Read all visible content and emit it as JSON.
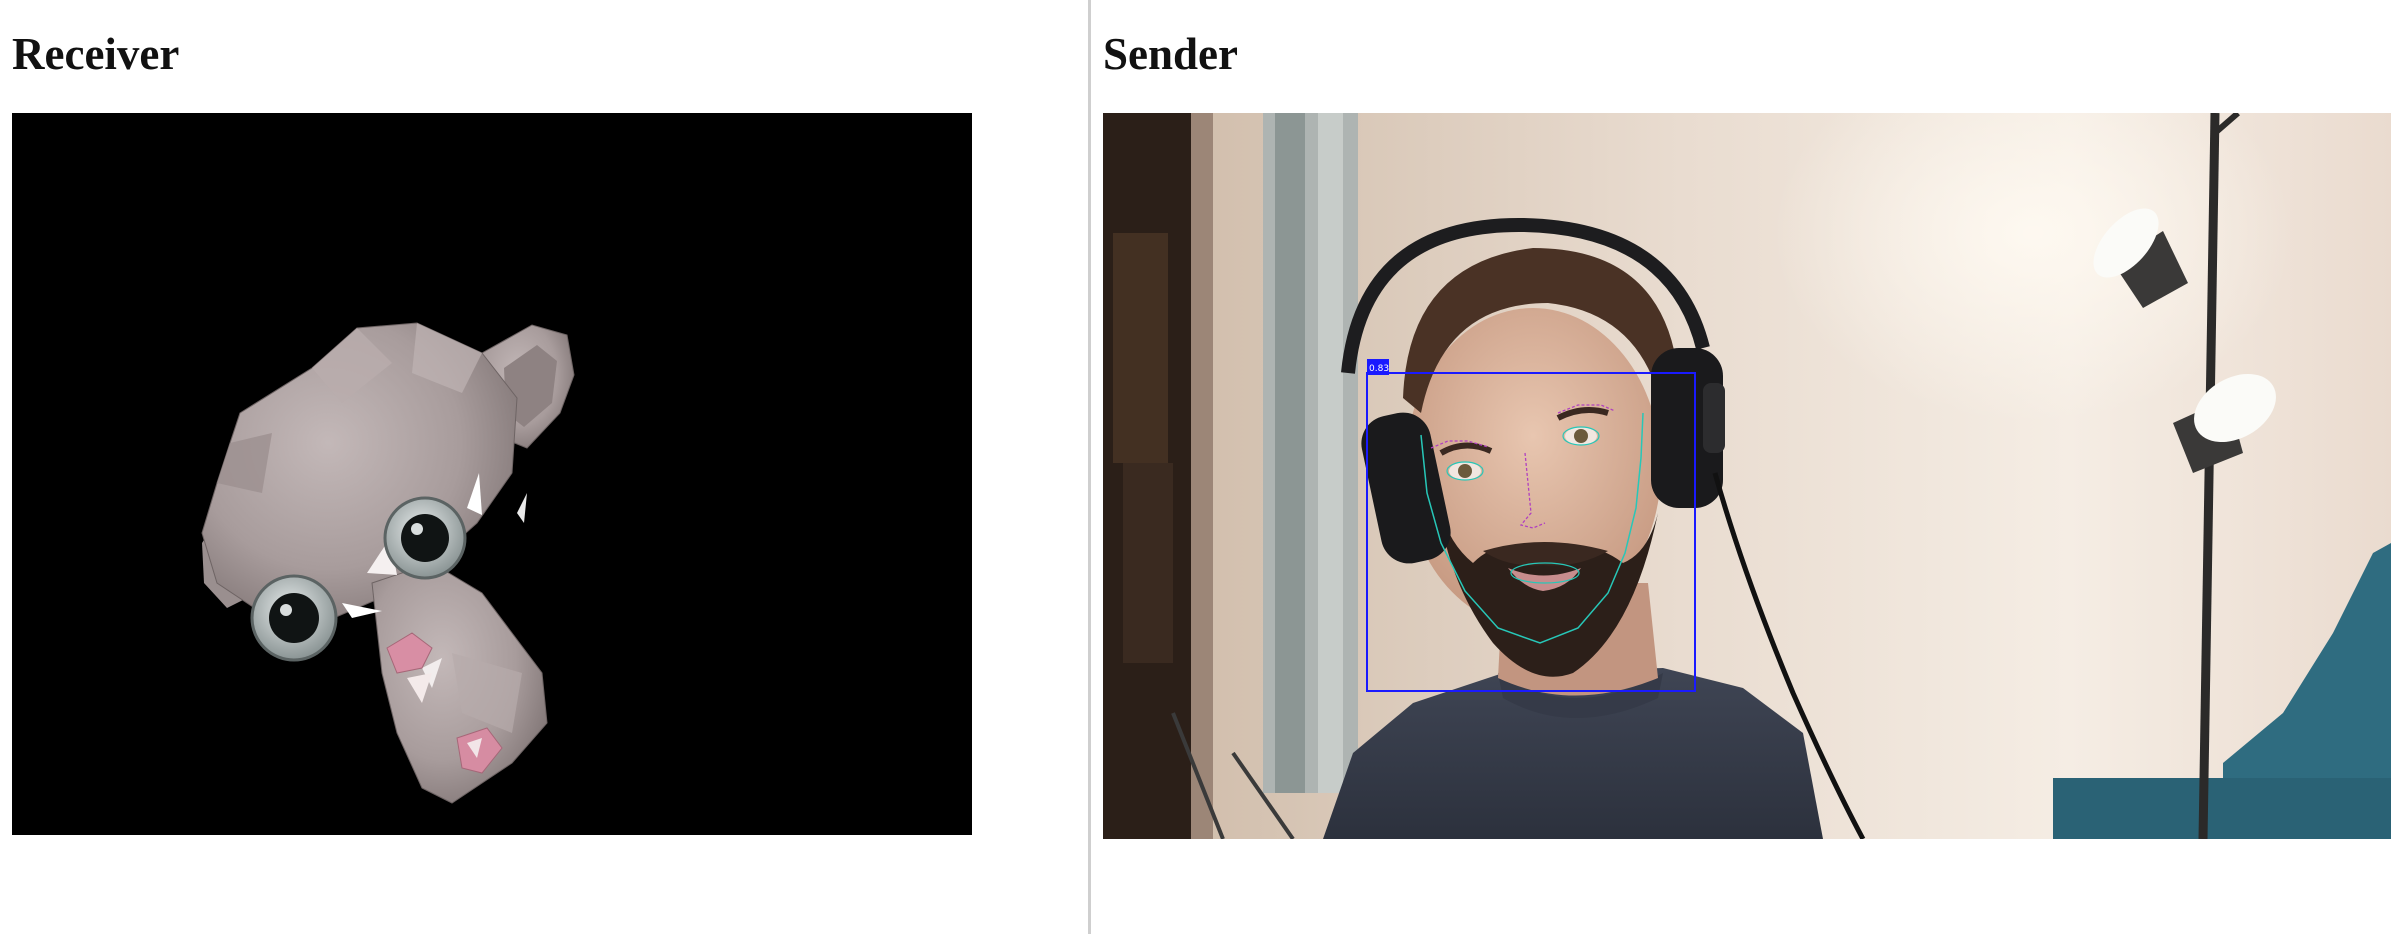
{
  "receiver": {
    "heading": "Receiver",
    "background_color": "#000000"
  },
  "sender": {
    "heading": "Sender",
    "detection": {
      "confidence_label": "0.83",
      "box_color": "#1a1aff",
      "landmark_color": "#27c7b8"
    }
  }
}
